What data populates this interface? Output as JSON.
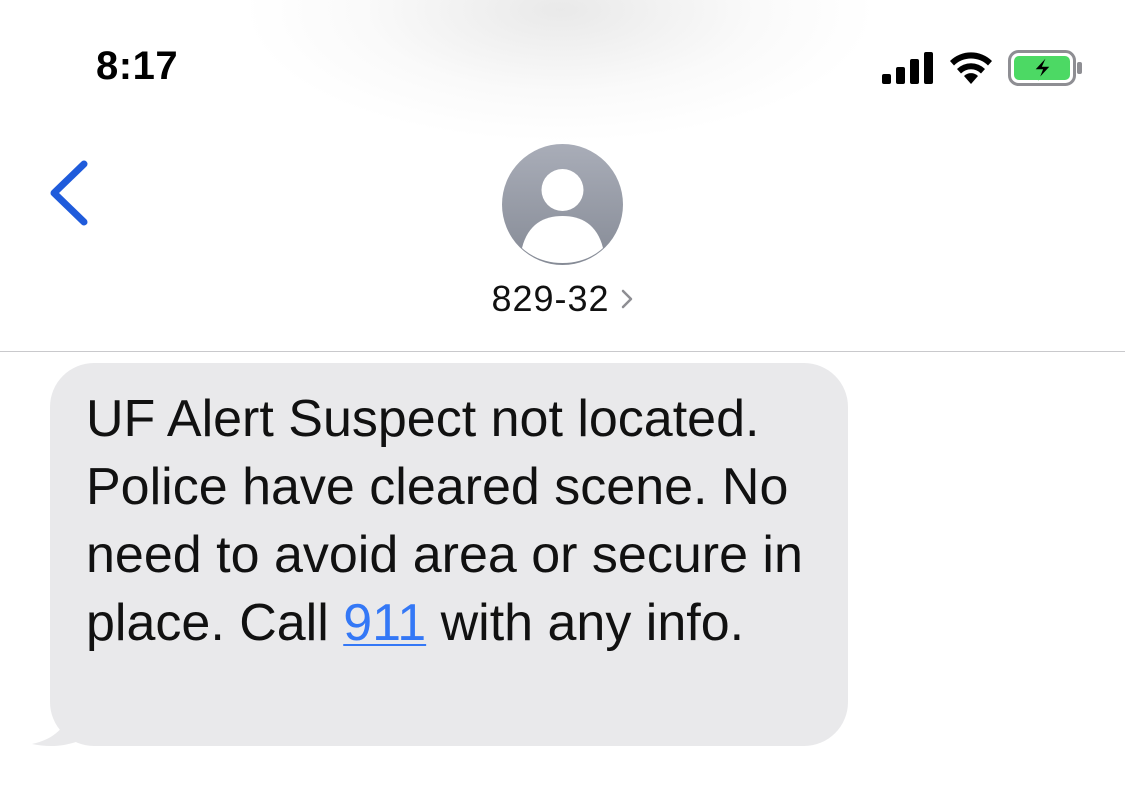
{
  "status_bar": {
    "time": "8:17",
    "signal_icon": "cellular-signal-icon",
    "wifi_icon": "wifi-icon",
    "battery_icon": "battery-charging-icon",
    "battery_color": "#4cd964"
  },
  "header": {
    "back_icon": "chevron-left-icon",
    "avatar_icon": "person-placeholder-icon",
    "contact_name": "829-32",
    "contact_chevron_icon": "chevron-right-icon",
    "accent_color": "#1f5bdb"
  },
  "message": {
    "direction": "incoming",
    "text_before_link": "UF Alert Suspect not located. Police have cleared scene. No need to avoid area or secure in place. Call ",
    "link_text": "911",
    "text_after_link": " with any info.",
    "bubble_color": "#e9e9eb",
    "link_color": "#3478f6"
  }
}
